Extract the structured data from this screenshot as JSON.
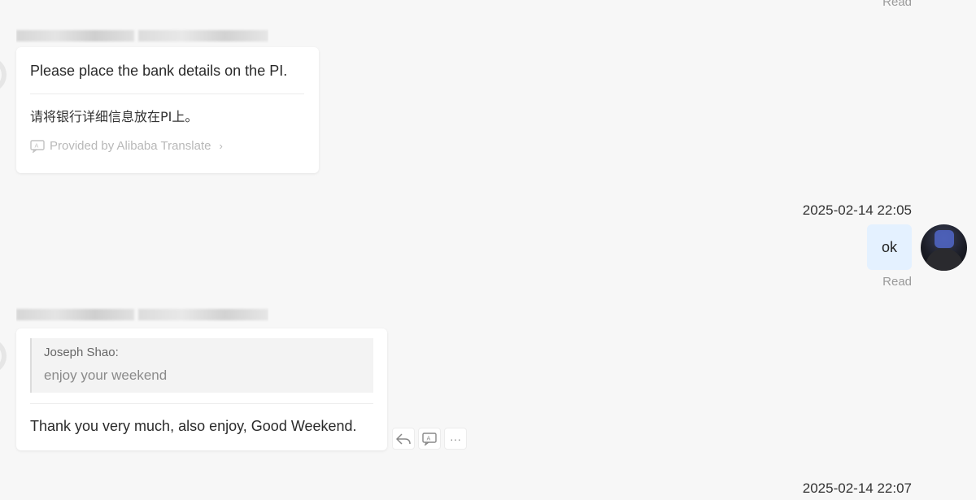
{
  "top": {
    "read_label": "Read"
  },
  "message1": {
    "original": "Please place the bank details on the PI.",
    "translation": "请将银行详细信息放在PI上。",
    "provider": "Provided by Alibaba Translate",
    "provider_chevron": "›"
  },
  "my_message": {
    "timestamp": "2025-02-14 22:05",
    "text": "ok",
    "status": "Read"
  },
  "message2": {
    "quote_author": "Joseph Shao:",
    "quote_text": "enjoy your weekend",
    "text": "Thank you very much, also enjoy, Good Weekend."
  },
  "actions": {
    "more_label": "···"
  },
  "bottom": {
    "timestamp": "2025-02-14 22:07"
  },
  "colors": {
    "my_bubble": "#e4f1ff",
    "background": "#f7f7f7",
    "muted": "#9a9a9a"
  },
  "icons": [
    "translate-icon",
    "reply-icon",
    "more-icon"
  ]
}
